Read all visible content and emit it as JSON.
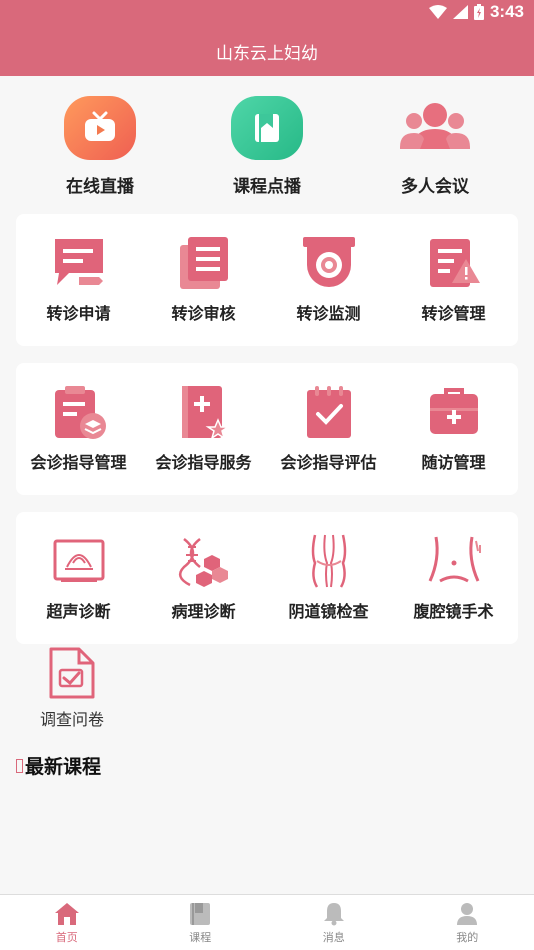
{
  "status": {
    "time": "3:43"
  },
  "header": {
    "title": "山东云上妇幼"
  },
  "top_features": [
    {
      "label": "在线直播",
      "icon": "tv-icon",
      "color": "#f47a50"
    },
    {
      "label": "课程点播",
      "icon": "book-icon",
      "color": "#3dc79a"
    },
    {
      "label": "多人会议",
      "icon": "group-icon",
      "color": "#e76f7e"
    }
  ],
  "referral_card": [
    {
      "label": "转诊申请",
      "icon": "referral-apply-icon"
    },
    {
      "label": "转诊审核",
      "icon": "referral-review-icon"
    },
    {
      "label": "转诊监测",
      "icon": "referral-monitor-icon"
    },
    {
      "label": "转诊管理",
      "icon": "referral-manage-icon"
    }
  ],
  "consult_card": [
    {
      "label": "会诊指导管理",
      "icon": "consult-manage-icon"
    },
    {
      "label": "会诊指导服务",
      "icon": "consult-service-icon"
    },
    {
      "label": "会诊指导评估",
      "icon": "consult-evaluate-icon"
    },
    {
      "label": "随访管理",
      "icon": "followup-kit-icon"
    }
  ],
  "diagnosis_card": [
    {
      "label": "超声诊断",
      "icon": "ultrasound-icon"
    },
    {
      "label": "病理诊断",
      "icon": "dna-icon"
    },
    {
      "label": "阴道镜检查",
      "icon": "colposcopy-icon"
    },
    {
      "label": "腹腔镜手术",
      "icon": "abdomen-icon"
    }
  ],
  "survey": {
    "label": "调查问卷",
    "icon": "survey-icon"
  },
  "section": {
    "title": "最新课程"
  },
  "tabs": [
    {
      "label": "首页",
      "icon": "home-icon",
      "active": true
    },
    {
      "label": "课程",
      "icon": "course-icon",
      "active": false
    },
    {
      "label": "消息",
      "icon": "bell-icon",
      "active": false
    },
    {
      "label": "我的",
      "icon": "user-icon",
      "active": false
    }
  ],
  "colors": {
    "brand": "#d9697b",
    "icon_primary": "#e0647a"
  }
}
